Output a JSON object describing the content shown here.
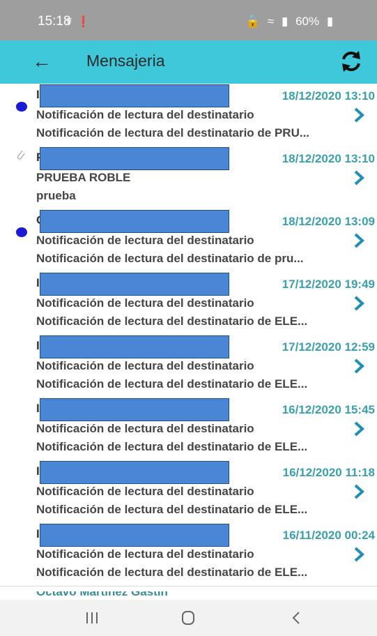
{
  "status_bar": {
    "time": "15:18",
    "battery": "60%",
    "icons": [
      "usb-icon",
      "alert-icon",
      "lock-icon",
      "wifi-icon",
      "signal-icon",
      "battery-icon"
    ]
  },
  "app_bar": {
    "title": "Mensajeria",
    "icons": [
      "back-arrow-icon",
      "refresh-icon"
    ],
    "accent_color": "#3ec8d9"
  },
  "messages": [
    {
      "sender": "I",
      "unread": true,
      "attachment": false,
      "redacted": true,
      "date": "18/12/2020 13:10",
      "subject": "Notificación de lectura del destinatario",
      "preview": "Notificación de lectura del destinatario de PRU..."
    },
    {
      "sender": "P",
      "unread": false,
      "attachment": true,
      "redacted": true,
      "date": "18/12/2020 13:10",
      "subject": "PRUEBA ROBLE",
      "preview": "prueba"
    },
    {
      "sender": "C",
      "unread": true,
      "attachment": false,
      "redacted": true,
      "date": "18/12/2020 13:09",
      "subject": "Notificación de lectura del destinatario",
      "preview": "Notificación de lectura del destinatario de pru..."
    },
    {
      "sender": "I",
      "unread": false,
      "attachment": false,
      "redacted": true,
      "date": "17/12/2020 19:49",
      "subject": "Notificación de lectura del destinatario",
      "preview": "Notificación de lectura del destinatario de ELE..."
    },
    {
      "sender": "I",
      "unread": false,
      "attachment": false,
      "redacted": true,
      "date": "17/12/2020 12:59",
      "subject": "Notificación de lectura del destinatario",
      "preview": "Notificación de lectura del destinatario de ELE..."
    },
    {
      "sender": "I",
      "unread": false,
      "attachment": false,
      "redacted": true,
      "date": "16/12/2020 15:45",
      "subject": "Notificación de lectura del destinatario",
      "preview": "Notificación de lectura del destinatario de ELE..."
    },
    {
      "sender": "I",
      "unread": false,
      "attachment": false,
      "redacted": true,
      "date": "16/12/2020 11:18",
      "subject": "Notificación de lectura del destinatario",
      "preview": "Notificación de lectura del destinatario de ELE..."
    },
    {
      "sender": "I",
      "unread": false,
      "attachment": false,
      "redacted": true,
      "date": "16/11/2020 00:24",
      "subject": "Notificación de lectura del destinatario",
      "preview": "Notificación de lectura del destinatario de ELE..."
    }
  ],
  "partial_row": {
    "sender": "Octavo Martínez Gastin"
  },
  "nav_bar": {
    "icons": [
      "recent-apps-icon",
      "home-icon",
      "back-icon"
    ]
  },
  "colors": {
    "date_color": "#3aa0ad",
    "unread_dot": "#1b1bd6",
    "redaction": "#4a86d4",
    "status_bar": "#9e9e9e"
  }
}
